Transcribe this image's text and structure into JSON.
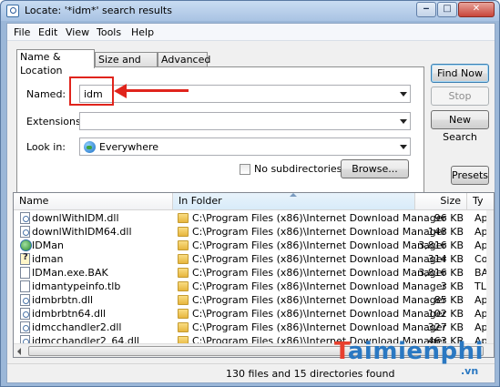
{
  "window": {
    "title": "Locate: '*idm*' search results",
    "minimize_glyph": "‒",
    "maximize_glyph": "□",
    "close_glyph": "✕"
  },
  "menu": [
    "File",
    "Edit",
    "View",
    "Tools",
    "Help"
  ],
  "tabs": [
    "Name & Location",
    "Size and Date",
    "Advanced"
  ],
  "form": {
    "named_label": "Named:",
    "named_value": "idm",
    "extensions_label": "Extensions:",
    "extensions_value": "",
    "lookin_label": "Look in:",
    "lookin_value": "Everywhere",
    "no_subdirs_label": "No subdirectories",
    "no_subdirs_checked": false,
    "browse_label": "Browse..."
  },
  "buttons": {
    "find_now": "Find Now",
    "stop": "Stop",
    "new_search": "New Search",
    "presets": "Presets"
  },
  "columns": {
    "name": "Name",
    "in_folder": "In Folder",
    "size": "Size",
    "type": "Ty"
  },
  "rows": [
    {
      "name": "downlWithIDM.dll",
      "folder": "C:\\Program Files (x86)\\Internet Download Manager",
      "size": "96 KB",
      "type": "Ap",
      "icon": "dll-file-icon"
    },
    {
      "name": "downlWithIDM64.dll",
      "folder": "C:\\Program Files (x86)\\Internet Download Manager",
      "size": "148 KB",
      "type": "Ap",
      "icon": "dll-file-icon"
    },
    {
      "name": "IDMan",
      "folder": "C:\\Program Files (x86)\\Internet Download Manager",
      "size": "3,816 KB",
      "type": "Ap",
      "icon": "application-icon"
    },
    {
      "name": "idman",
      "folder": "C:\\Program Files (x86)\\Internet Download Manager",
      "size": "314 KB",
      "type": "Co",
      "icon": "config-file-icon"
    },
    {
      "name": "IDMan.exe.BAK",
      "folder": "C:\\Program Files (x86)\\Internet Download Manager",
      "size": "3,816 KB",
      "type": "BA",
      "icon": "generic-file-icon"
    },
    {
      "name": "idmantypeinfo.tlb",
      "folder": "C:\\Program Files (x86)\\Internet Download Manager",
      "size": "3 KB",
      "type": "TL",
      "icon": "generic-file-icon"
    },
    {
      "name": "idmbrbtn.dll",
      "folder": "C:\\Program Files (x86)\\Internet Download Manager",
      "size": "85 KB",
      "type": "Ap",
      "icon": "dll-file-icon"
    },
    {
      "name": "idmbrbtn64.dll",
      "folder": "C:\\Program Files (x86)\\Internet Download Manager",
      "size": "102 KB",
      "type": "Ap",
      "icon": "dll-file-icon"
    },
    {
      "name": "idmcchandler2.dll",
      "folder": "C:\\Program Files (x86)\\Internet Download Manager",
      "size": "327 KB",
      "type": "Ap",
      "icon": "dll-file-icon"
    },
    {
      "name": "idmcchandler2_64.dll",
      "folder": "C:\\Program Files (x86)\\Internet Download Manager",
      "size": "463 KB",
      "type": "Ap",
      "icon": "dll-file-icon"
    }
  ],
  "status": "130 files and 15 directories found",
  "watermark": {
    "main_a": "",
    "main_t": "T",
    "main_b": "aimienphi",
    "sub": ".vn"
  },
  "annotation_color": "#e0241c"
}
